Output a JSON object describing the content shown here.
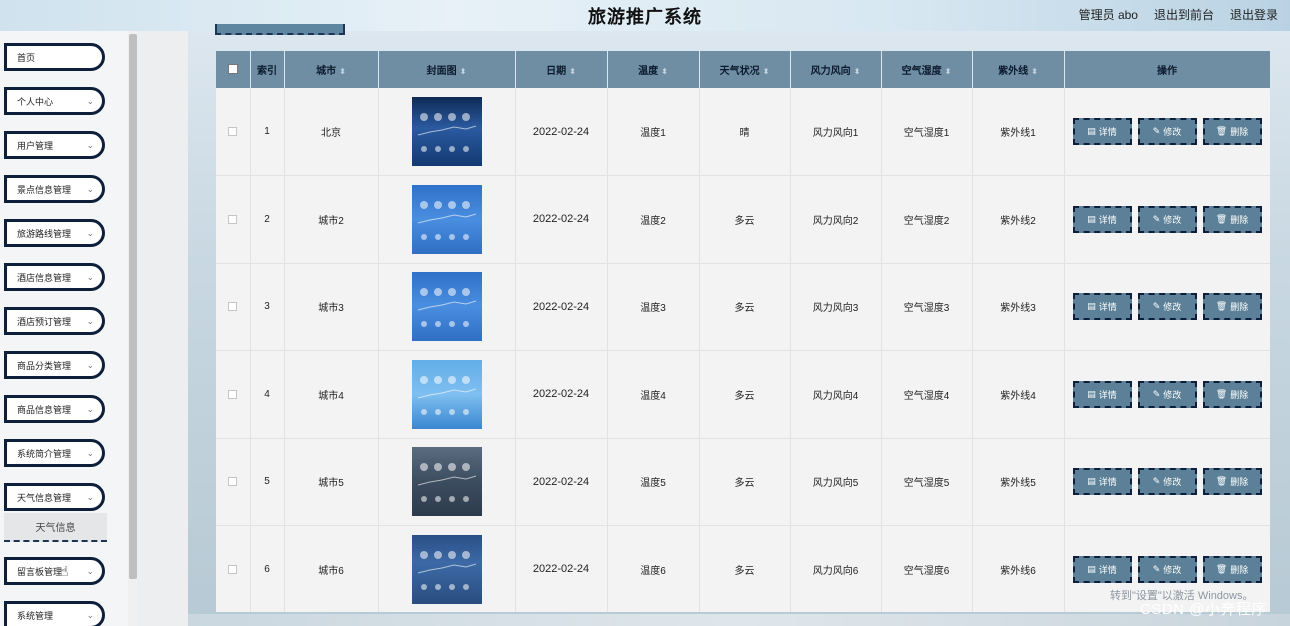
{
  "header": {
    "title": "旅游推广系统",
    "admin_label": "管理员 abo",
    "to_front": "退出到前台",
    "logout": "退出登录"
  },
  "sidebar": {
    "items": [
      {
        "label": "首页",
        "has_chevron": false
      },
      {
        "label": "个人中心",
        "has_chevron": true
      },
      {
        "label": "用户管理",
        "has_chevron": true
      },
      {
        "label": "景点信息管理",
        "has_chevron": true
      },
      {
        "label": "旅游路线管理",
        "has_chevron": true
      },
      {
        "label": "酒店信息管理",
        "has_chevron": true
      },
      {
        "label": "酒店预订管理",
        "has_chevron": true
      },
      {
        "label": "商品分类管理",
        "has_chevron": true
      },
      {
        "label": "商品信息管理",
        "has_chevron": true
      },
      {
        "label": "系统简介管理",
        "has_chevron": true
      },
      {
        "label": "天气信息管理",
        "has_chevron": true
      },
      {
        "label": "留言板管理",
        "has_chevron": true
      },
      {
        "label": "系统管理",
        "has_chevron": true
      }
    ],
    "submenu": {
      "label": "天气信息"
    }
  },
  "table": {
    "columns": [
      "索引",
      "城市",
      "封面图",
      "日期",
      "温度",
      "天气状况",
      "风力风向",
      "空气湿度",
      "紫外线",
      "操作"
    ],
    "rows": [
      {
        "index": "1",
        "city": "北京",
        "date": "2022-02-24",
        "temp": "温度1",
        "weather": "晴",
        "wind": "风力风向1",
        "humidity": "空气湿度1",
        "uv": "紫外线1",
        "cover": "weather-app-dark-icon"
      },
      {
        "index": "2",
        "city": "城市2",
        "date": "2022-02-24",
        "temp": "温度2",
        "weather": "多云",
        "wind": "风力风向2",
        "humidity": "空气湿度2",
        "uv": "紫外线2",
        "cover": "weather-forecast-blue-icon"
      },
      {
        "index": "3",
        "city": "城市3",
        "date": "2022-02-24",
        "temp": "温度3",
        "weather": "多云",
        "wind": "风力风向3",
        "humidity": "空气湿度3",
        "uv": "紫外线3",
        "cover": "weather-forecast-blue-icon"
      },
      {
        "index": "4",
        "city": "城市4",
        "date": "2022-02-24",
        "temp": "温度4",
        "weather": "多云",
        "wind": "风力风向4",
        "humidity": "空气湿度4",
        "uv": "紫外线4",
        "cover": "weather-forecast-light-icon"
      },
      {
        "index": "5",
        "city": "城市5",
        "date": "2022-02-24",
        "temp": "温度5",
        "weather": "多云",
        "wind": "风力风向5",
        "humidity": "空气湿度5",
        "uv": "紫外线5",
        "cover": "weather-forecast-gray-icon"
      },
      {
        "index": "6",
        "city": "城市6",
        "date": "2022-02-24",
        "temp": "温度6",
        "weather": "多云",
        "wind": "风力风向6",
        "humidity": "空气湿度6",
        "uv": "紫外线6",
        "cover": "weather-forecast-navy-icon"
      }
    ],
    "actions": {
      "detail": "详情",
      "edit": "修改",
      "delete": "删除"
    }
  },
  "watermark": {
    "activate_hint": "转到\"设置\"以激活 Windows。",
    "csdn": "CSDN @小奔程序"
  },
  "colors": {
    "header_bg": "#6f8ea3",
    "button_bg": "#5c8097",
    "menu_border": "#0d1f3a"
  }
}
